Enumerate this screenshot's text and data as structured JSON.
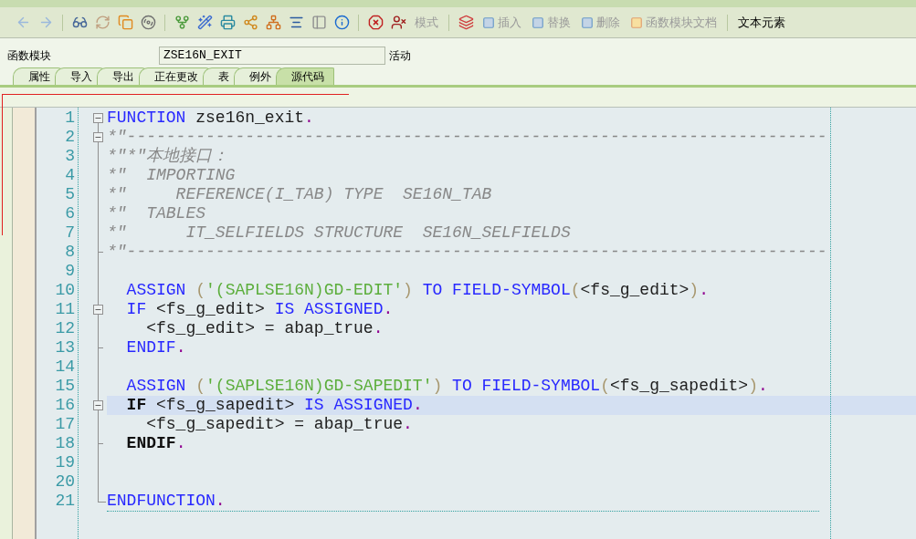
{
  "toolbar": {
    "text_buttons": [
      {
        "label": "模式",
        "disabled": true
      },
      {
        "label": "插入",
        "disabled": true
      },
      {
        "label": "替换",
        "disabled": true
      },
      {
        "label": "删除",
        "disabled": true
      },
      {
        "label": "函数模块文档",
        "disabled": true
      },
      {
        "label": "文本元素",
        "disabled": false
      }
    ]
  },
  "header": {
    "label": "函数模块",
    "value": "ZSE16N_EXIT",
    "status": "活动"
  },
  "tabs": [
    {
      "label": "属性",
      "selected": false
    },
    {
      "label": "导入",
      "selected": false
    },
    {
      "label": "导出",
      "selected": false
    },
    {
      "label": "正在更改",
      "selected": false
    },
    {
      "label": "表",
      "selected": false
    },
    {
      "label": "例外",
      "selected": false
    },
    {
      "label": "源代码",
      "selected": true
    }
  ],
  "editor": {
    "lines": [
      {
        "number": "1",
        "kind": "start",
        "current": false,
        "tokens": [
          {
            "kind": "keyword",
            "t": "FUNCTION"
          },
          {
            "kind": "ident",
            "t": " zse16n_exit"
          },
          {
            "kind": "period",
            "t": "."
          }
        ]
      },
      {
        "number": "2",
        "kind": "start",
        "current": false,
        "tokens": [
          {
            "kind": "comment",
            "t": "*\"-----------------------------------------------------------------------"
          }
        ]
      },
      {
        "number": "3",
        "kind": "inner",
        "current": false,
        "tokens": [
          {
            "kind": "comment",
            "t": "*\"*\"本地接口："
          }
        ]
      },
      {
        "number": "4",
        "kind": "inner",
        "current": false,
        "tokens": [
          {
            "kind": "comment",
            "t": "*\"  IMPORTING"
          }
        ]
      },
      {
        "number": "5",
        "kind": "inner",
        "current": false,
        "tokens": [
          {
            "kind": "comment",
            "t": "*\"     REFERENCE(I_TAB) TYPE  SE16N_TAB"
          }
        ]
      },
      {
        "number": "6",
        "kind": "inner",
        "current": false,
        "tokens": [
          {
            "kind": "comment",
            "t": "*\"  TABLES"
          }
        ]
      },
      {
        "number": "7",
        "kind": "inner",
        "current": false,
        "tokens": [
          {
            "kind": "comment",
            "t": "*\"      IT_SELFIELDS STRUCTURE  SE16N_SELFIELDS"
          }
        ]
      },
      {
        "number": "8",
        "kind": "end",
        "current": false,
        "tokens": [
          {
            "kind": "comment",
            "t": "*\"-----------------------------------------------------------------------"
          }
        ]
      },
      {
        "number": "9",
        "kind": "inner",
        "current": false
      },
      {
        "number": "10",
        "kind": "inner",
        "current": false,
        "tokens": [
          {
            "kind": "keyword",
            "t": "  ASSIGN "
          },
          {
            "kind": "paren",
            "t": "("
          },
          {
            "kind": "string",
            "t": "'(SAPLSE16N)GD-EDIT'"
          },
          {
            "kind": "paren",
            "t": ")"
          },
          {
            "kind": "keyword",
            "t": " TO FIELD-SYMBOL"
          },
          {
            "kind": "paren",
            "t": "("
          },
          {
            "kind": "ident",
            "t": "<fs_g_edit>"
          },
          {
            "kind": "paren",
            "t": ")"
          },
          {
            "kind": "period",
            "t": "."
          }
        ]
      },
      {
        "number": "11",
        "kind": "start",
        "current": false,
        "tokens": [
          {
            "kind": "keyword",
            "t": "  IF "
          },
          {
            "kind": "ident",
            "t": "<fs_g_edit>"
          },
          {
            "kind": "keyword",
            "t": " IS ASSIGNED"
          },
          {
            "kind": "period",
            "t": "."
          }
        ]
      },
      {
        "number": "12",
        "kind": "inner",
        "current": false,
        "tokens": [
          {
            "kind": "ident",
            "t": "    <fs_g_edit> = abap_true"
          },
          {
            "kind": "period",
            "t": "."
          }
        ]
      },
      {
        "number": "13",
        "kind": "end",
        "current": false,
        "tokens": [
          {
            "kind": "keyword",
            "t": "  ENDIF"
          },
          {
            "kind": "period",
            "t": "."
          }
        ]
      },
      {
        "number": "14",
        "kind": "inner",
        "current": false
      },
      {
        "number": "15",
        "kind": "inner",
        "current": false,
        "tokens": [
          {
            "kind": "keyword",
            "t": "  ASSIGN "
          },
          {
            "kind": "paren",
            "t": "("
          },
          {
            "kind": "string",
            "t": "'(SAPLSE16N)GD-SAPEDIT'"
          },
          {
            "kind": "paren",
            "t": ")"
          },
          {
            "kind": "keyword",
            "t": " TO FIELD-SYMBOL"
          },
          {
            "kind": "paren",
            "t": "("
          },
          {
            "kind": "ident",
            "t": "<fs_g_sapedit>"
          },
          {
            "kind": "paren",
            "t": ")"
          },
          {
            "kind": "period",
            "t": "."
          }
        ]
      },
      {
        "number": "16",
        "kind": "start",
        "current": true,
        "tokens": [
          {
            "kind": "bold",
            "t": "  IF "
          },
          {
            "kind": "ident",
            "t": "<fs_g_sapedit>"
          },
          {
            "kind": "keyword",
            "t": " IS ASSIGNED"
          },
          {
            "kind": "period",
            "t": "."
          }
        ]
      },
      {
        "number": "17",
        "kind": "inner",
        "current": false,
        "tokens": [
          {
            "kind": "ident",
            "t": "    <fs_g_sapedit> = abap_true"
          },
          {
            "kind": "period",
            "t": "."
          }
        ]
      },
      {
        "number": "18",
        "kind": "end",
        "current": false,
        "tokens": [
          {
            "kind": "bold",
            "t": "  ENDIF"
          },
          {
            "kind": "period",
            "t": "."
          }
        ]
      },
      {
        "number": "19",
        "kind": "inner",
        "current": false
      },
      {
        "number": "20",
        "kind": "inner",
        "current": false
      },
      {
        "number": "21",
        "kind": "last",
        "current": false,
        "tokens": [
          {
            "kind": "keyword",
            "t": "ENDFUNCTION"
          },
          {
            "kind": "period",
            "t": "."
          }
        ]
      }
    ]
  }
}
